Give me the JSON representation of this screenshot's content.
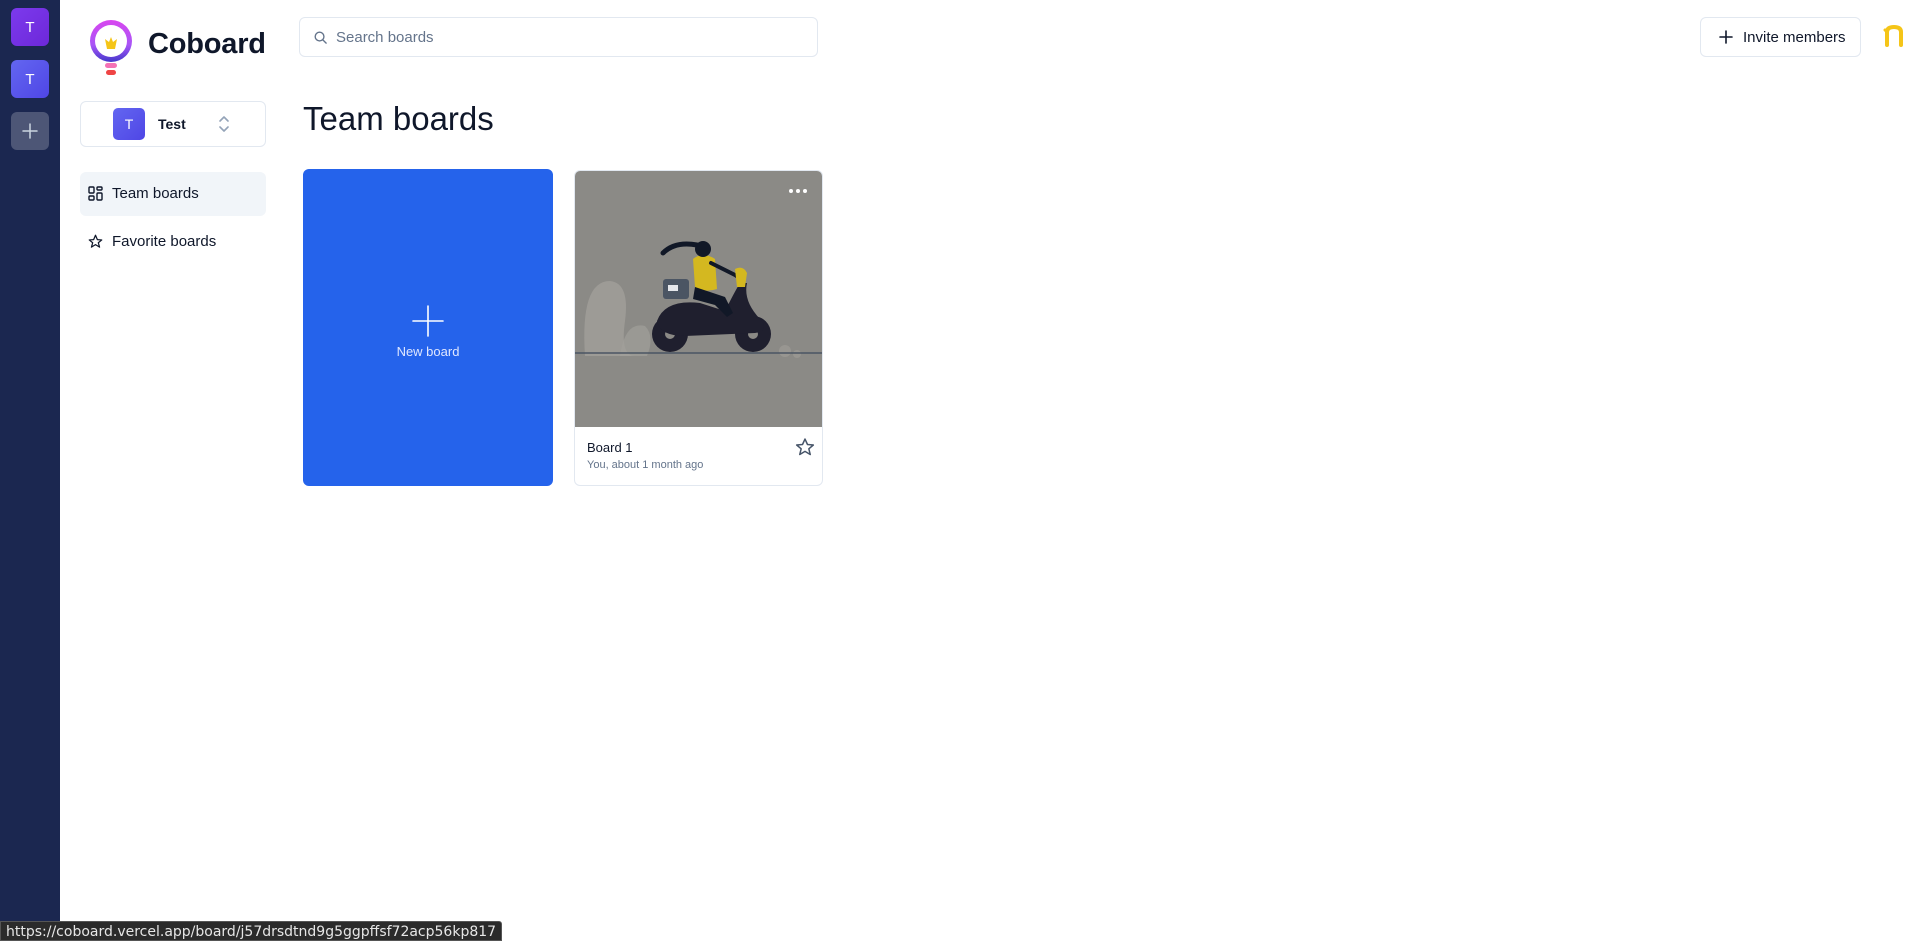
{
  "org_rail": {
    "orgs": [
      {
        "initial": "T"
      },
      {
        "initial": "T"
      }
    ],
    "add_icon": "plus-icon"
  },
  "app": {
    "name": "Coboard",
    "logo_icon": "lightbulb-logo"
  },
  "org_switcher": {
    "initial": "T",
    "name": "Test",
    "icon": "chevrons-up-down-icon"
  },
  "nav": {
    "items": [
      {
        "label": "Team boards",
        "icon": "grid-icon",
        "active": true
      },
      {
        "label": "Favorite boards",
        "icon": "star-icon",
        "active": false
      }
    ]
  },
  "search": {
    "placeholder": "Search boards",
    "value": "",
    "icon": "search-icon"
  },
  "header": {
    "invite_label": "Invite members",
    "user_initial": "n"
  },
  "main": {
    "title": "Team boards",
    "new_board_label": "New board",
    "boards": [
      {
        "title": "Board 1",
        "meta": "You, about 1 month ago",
        "favorite": false
      }
    ]
  },
  "status_bar": {
    "url": "https://coboard.vercel.app/board/j57drsdtnd9g5ggpffsf72acp56kp817"
  },
  "colors": {
    "rail_bg": "#1b2750",
    "accent": "#2563eb",
    "thumb_bg": "#8b8a86",
    "user_avatar": "#f5c518"
  }
}
